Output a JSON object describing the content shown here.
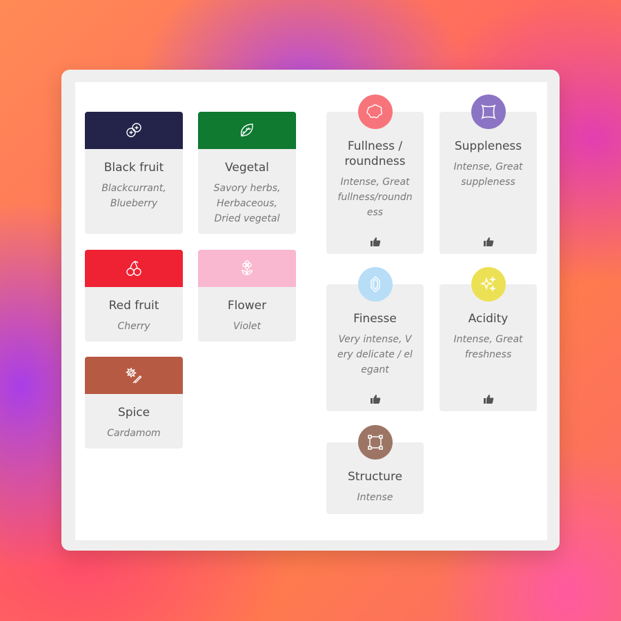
{
  "aromas": [
    {
      "title": "Black fruit",
      "desc": "Blackcurrant, Blueberry",
      "color": "#24244a",
      "icon": "berries-icon"
    },
    {
      "title": "Vegetal",
      "desc": "Savory herbs, Herbaceous, Dried vegetal",
      "color": "#0f7a30",
      "icon": "leaf-icon"
    },
    {
      "title": "Red fruit",
      "desc": "Cherry",
      "color": "#ee2233",
      "icon": "cherry-icon"
    },
    {
      "title": "Flower",
      "desc": "Violet",
      "color": "#f9b8cf",
      "icon": "flower-icon"
    },
    {
      "title": "Spice",
      "desc": "Cardamom",
      "color": "#b75a43",
      "icon": "spice-icon"
    }
  ],
  "traits": [
    {
      "title": "Fullness / roundness",
      "desc": "Intense, Great fullness/roundness",
      "color": "#f7747b",
      "icon": "round-badge-icon",
      "liked": true
    },
    {
      "title": "Suppleness",
      "desc": "Intense, Great suppleness",
      "color": "#8c74c4",
      "icon": "square-curve-icon",
      "liked": true
    },
    {
      "title": "Finesse",
      "desc": "Very intense, Very delicate / elegant",
      "color": "#b8ddf7",
      "icon": "gem-icon",
      "liked": true
    },
    {
      "title": "Acidity",
      "desc": "Intense, Great freshness",
      "color": "#ece155",
      "icon": "sparkle-icon",
      "liked": true
    },
    {
      "title": "Structure",
      "desc": "Intense",
      "color": "#9c7565",
      "icon": "frame-icon",
      "liked": false
    }
  ]
}
